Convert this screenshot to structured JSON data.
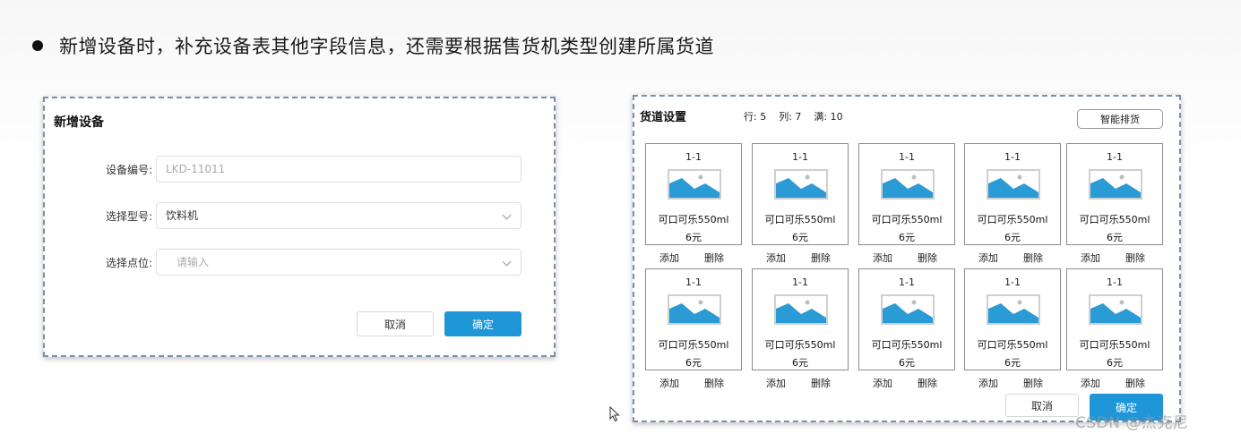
{
  "headline": "新增设备时，补充设备表其他字段信息，还需要根据售货机类型创建所属货道",
  "left_dialog": {
    "title": "新增设备",
    "fields": [
      {
        "label": "设备编号:",
        "value": "LKD-11011",
        "placeholder": true,
        "has_dropdown": false
      },
      {
        "label": "选择型号:",
        "value": "饮料机",
        "placeholder": false,
        "has_dropdown": true
      },
      {
        "label": "选择点位:",
        "value": "请输入",
        "placeholder": true,
        "has_dropdown": true
      }
    ],
    "cancel_label": "取消",
    "confirm_label": "确定"
  },
  "right_dialog": {
    "title": "货道设置",
    "rows_text": "行: 5",
    "cols_text": "列: 7",
    "full_text": "满: 10",
    "smart_button": "智能排货",
    "slots": [
      {
        "code": "1-1",
        "name": "可口可乐550ml",
        "price": "6元"
      },
      {
        "code": "1-1",
        "name": "可口可乐550ml",
        "price": "6元"
      },
      {
        "code": "1-1",
        "name": "可口可乐550ml",
        "price": "6元"
      },
      {
        "code": "1-1",
        "name": "可口可乐550ml",
        "price": "6元"
      },
      {
        "code": "1-1",
        "name": "可口可乐550ml",
        "price": "6元"
      },
      {
        "code": "1-1",
        "name": "可口可乐550ml",
        "price": "6元"
      },
      {
        "code": "1-1",
        "name": "可口可乐550ml",
        "price": "6元"
      },
      {
        "code": "1-1",
        "name": "可口可乐550ml",
        "price": "6元"
      },
      {
        "code": "1-1",
        "name": "可口可乐550ml",
        "price": "6元"
      },
      {
        "code": "1-1",
        "name": "可口可乐550ml",
        "price": "6元"
      }
    ],
    "add_label": "添加",
    "delete_label": "删除",
    "cancel_label": "取消",
    "confirm_label": "确定"
  },
  "watermark": "CSDN @杰克尼",
  "colors": {
    "primary": "#1e96d8",
    "image_blue": "#2b9bd6",
    "border": "#7a8fa8"
  }
}
